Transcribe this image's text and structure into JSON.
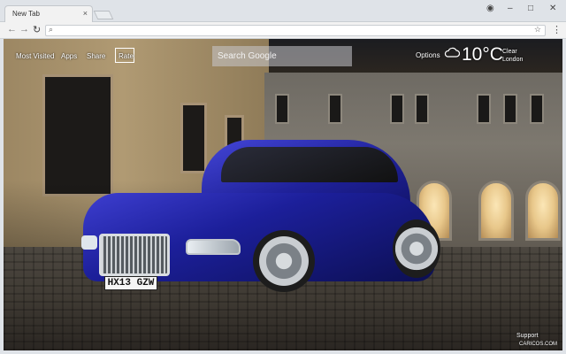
{
  "browser": {
    "tab_title": "New Tab",
    "close_glyph": "×",
    "profile_glyph": "◉",
    "minimize_glyph": "–",
    "maximize_glyph": "□",
    "window_close_glyph": "✕",
    "back_glyph": "←",
    "forward_glyph": "→",
    "reload_glyph": "↻",
    "search_glyph": "⌕",
    "star_glyph": "☆",
    "menu_glyph": "⋮"
  },
  "page": {
    "nav": [
      "Most Visited",
      "Apps",
      "Share",
      "Rate"
    ],
    "search": {
      "placeholder": "Search Google"
    },
    "options_label": "Options",
    "weather": {
      "temperature": "10°C",
      "condition": "Clear",
      "location": "London"
    },
    "support_label": "Support",
    "credit": "CARICOS.COM",
    "plate_text": "HX13 GZW"
  },
  "colors": {
    "accent": "#ffffff",
    "car": "#2a2db8"
  }
}
